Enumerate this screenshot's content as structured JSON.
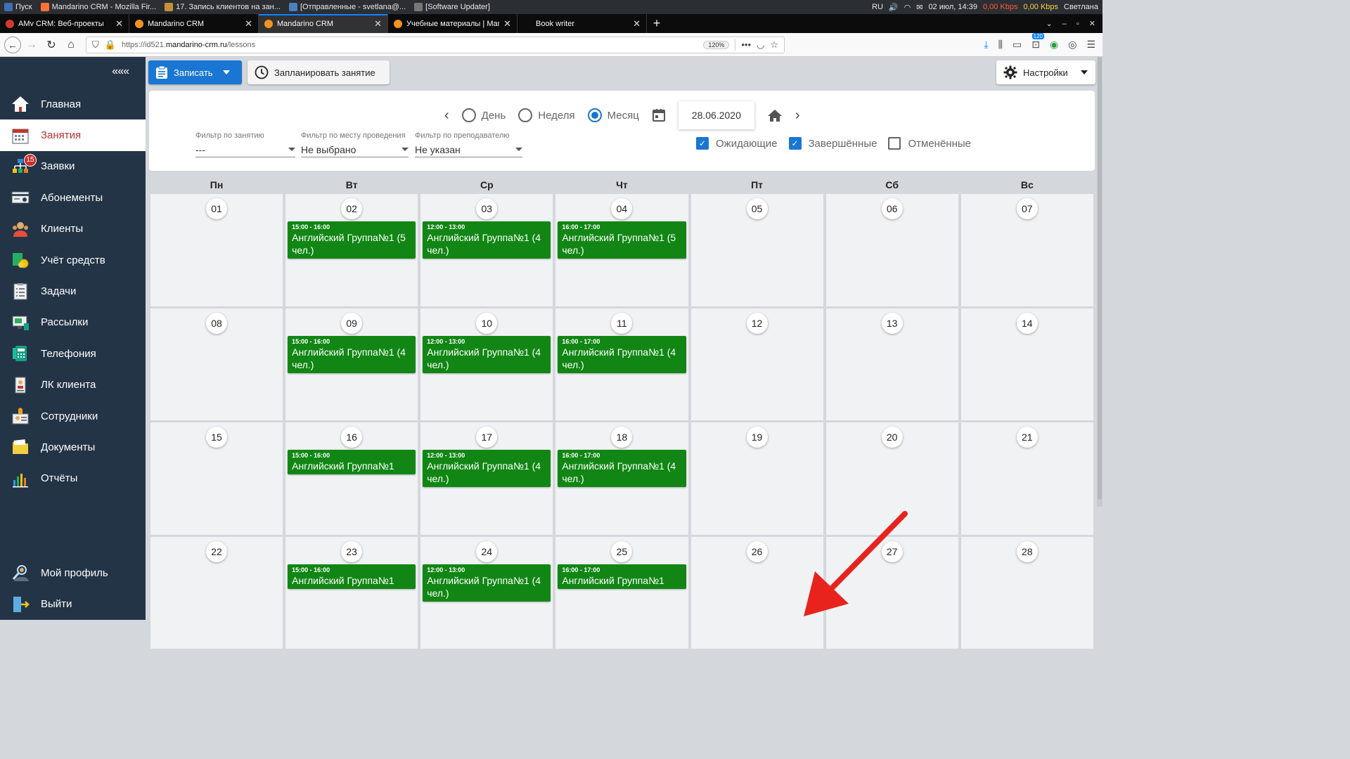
{
  "taskbar": {
    "items": [
      {
        "label": "Пуск",
        "color": "#3d6fb6"
      },
      {
        "label": "Mandarino CRM - Mozilla Fir...",
        "color": "#ff7139"
      },
      {
        "label": "17. Запись клиентов на зан...",
        "color": "#c88f3a"
      },
      {
        "label": "[Отправленные - svetlana@...",
        "color": "#4a7fc1"
      },
      {
        "label": "[Software Updater]",
        "color": "#777777"
      }
    ],
    "lang": "RU",
    "datetime": "02 июл, 14:39",
    "net_down": "0,00 Kbps",
    "net_up": "0,00 Kbps",
    "user": "Светлана"
  },
  "browser": {
    "tabs": [
      {
        "label": "AMv CRM: Веб-проекты",
        "color": "#d33b2c",
        "active": false
      },
      {
        "label": "Mandarino CRM",
        "color": "#f39322",
        "active": false
      },
      {
        "label": "Mandarino CRM",
        "color": "#f39322",
        "active": true
      },
      {
        "label": "Учебные материалы | Manu",
        "color": "#f39322",
        "active": false
      },
      {
        "label": "Book writer",
        "color": "#0c0c0d",
        "active": false
      }
    ],
    "url_prefix": "https://id521.",
    "url_host": "mandarino-crm.ru",
    "url_path": "/lessons",
    "zoom": "120%",
    "badge": "120"
  },
  "sidebar": {
    "collapse": "«««",
    "items": [
      {
        "label": "Главная",
        "icon": "home-icon",
        "active": false,
        "badge": ""
      },
      {
        "label": "Занятия",
        "icon": "calendar-icon",
        "active": true,
        "badge": ""
      },
      {
        "label": "Заявки",
        "icon": "requests-icon",
        "active": false,
        "badge": "15"
      },
      {
        "label": "Абонементы",
        "icon": "subscription-icon",
        "active": false,
        "badge": ""
      },
      {
        "label": "Клиенты",
        "icon": "clients-icon",
        "active": false,
        "badge": ""
      },
      {
        "label": "Учёт средств",
        "icon": "money-icon",
        "active": false,
        "badge": ""
      },
      {
        "label": "Задачи",
        "icon": "tasks-icon",
        "active": false,
        "badge": ""
      },
      {
        "label": "Рассылки",
        "icon": "mailing-icon",
        "active": false,
        "badge": ""
      },
      {
        "label": "Телефония",
        "icon": "phone-icon",
        "active": false,
        "badge": ""
      },
      {
        "label": "ЛК клиента",
        "icon": "client-cabinet-icon",
        "active": false,
        "badge": ""
      },
      {
        "label": "Сотрудники",
        "icon": "staff-icon",
        "active": false,
        "badge": ""
      },
      {
        "label": "Документы",
        "icon": "documents-icon",
        "active": false,
        "badge": ""
      },
      {
        "label": "Отчёты",
        "icon": "reports-icon",
        "active": false,
        "badge": ""
      }
    ],
    "bottom": [
      {
        "label": "Мой профиль",
        "icon": "profile-icon"
      },
      {
        "label": "Выйти",
        "icon": "logout-icon"
      }
    ]
  },
  "toolbar": {
    "record_label": "Записать",
    "schedule_label": "Запланировать занятие",
    "settings_label": "Настройки"
  },
  "view": {
    "day": "День",
    "week": "Неделя",
    "month": "Месяц",
    "selected": "month",
    "date": "28.06.2020"
  },
  "filters": {
    "lesson": {
      "label": "Фильтр по занятию",
      "value": "---"
    },
    "place": {
      "label": "Фильтр по месту проведения",
      "value": "Не выбрано"
    },
    "teacher": {
      "label": "Фильтр по преподавателю",
      "value": "Не указан"
    }
  },
  "status_checks": [
    {
      "label": "Ожидающие",
      "checked": true
    },
    {
      "label": "Завершённые",
      "checked": true
    },
    {
      "label": "Отменённые",
      "checked": false
    }
  ],
  "calendar": {
    "weekdays": [
      "Пн",
      "Вт",
      "Ср",
      "Чт",
      "Пт",
      "Сб",
      "Вс"
    ],
    "event_color": "#118614",
    "days": [
      {
        "n": "01"
      },
      {
        "n": "02",
        "ev": {
          "t": "15:00 - 16:00",
          "name": "Английский Группа№1 (5 чел.)"
        }
      },
      {
        "n": "03",
        "ev": {
          "t": "12:00 - 13:00",
          "name": "Английский Группа№1 (4 чел.)"
        }
      },
      {
        "n": "04",
        "ev": {
          "t": "16:00 - 17:00",
          "name": "Английский Группа№1 (5 чел.)"
        }
      },
      {
        "n": "05"
      },
      {
        "n": "06"
      },
      {
        "n": "07"
      },
      {
        "n": "08"
      },
      {
        "n": "09",
        "ev": {
          "t": "15:00 - 16:00",
          "name": "Английский Группа№1 (4 чел.)"
        }
      },
      {
        "n": "10",
        "ev": {
          "t": "12:00 - 13:00",
          "name": "Английский Группа№1 (4 чел.)"
        }
      },
      {
        "n": "11",
        "ev": {
          "t": "16:00 - 17:00",
          "name": "Английский Группа№1 (4 чел.)"
        }
      },
      {
        "n": "12"
      },
      {
        "n": "13"
      },
      {
        "n": "14"
      },
      {
        "n": "15"
      },
      {
        "n": "16",
        "ev": {
          "t": "15:00 - 16:00",
          "name": "Английский Группа№1"
        }
      },
      {
        "n": "17",
        "ev": {
          "t": "12:00 - 13:00",
          "name": "Английский Группа№1 (4 чел.)"
        }
      },
      {
        "n": "18",
        "ev": {
          "t": "16:00 - 17:00",
          "name": "Английский Группа№1 (4 чел.)"
        }
      },
      {
        "n": "19"
      },
      {
        "n": "20"
      },
      {
        "n": "21"
      },
      {
        "n": "22"
      },
      {
        "n": "23",
        "ev": {
          "t": "15:00 - 16:00",
          "name": "Английский Группа№1"
        }
      },
      {
        "n": "24",
        "ev": {
          "t": "12:00 - 13:00",
          "name": "Английский Группа№1 (4 чел.)"
        }
      },
      {
        "n": "25",
        "ev": {
          "t": "16:00 - 17:00",
          "name": "Английский Группа№1"
        }
      },
      {
        "n": "26"
      },
      {
        "n": "27"
      },
      {
        "n": "28"
      }
    ]
  },
  "annotation_arrow_color": "#e8231d"
}
